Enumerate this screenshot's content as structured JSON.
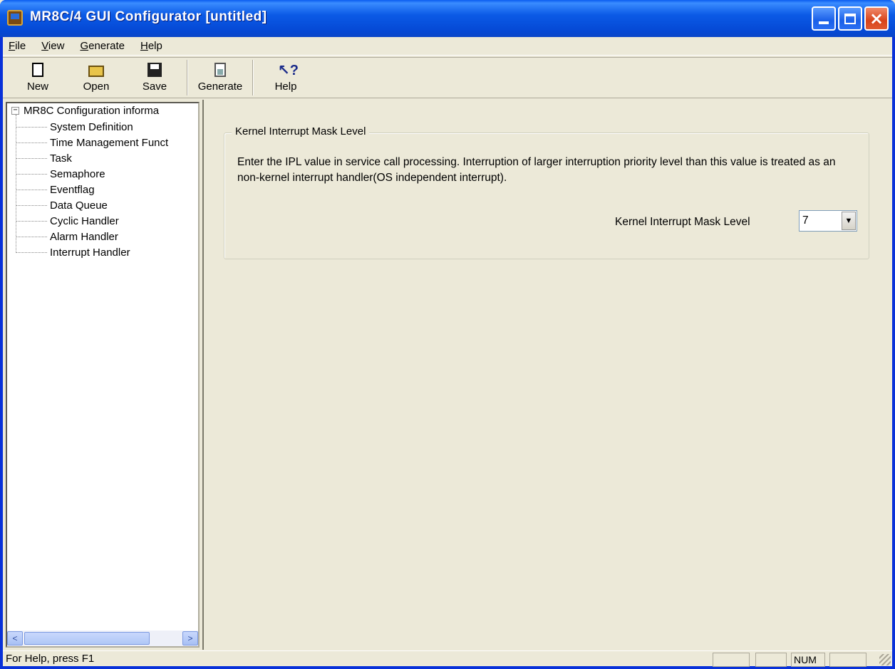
{
  "window": {
    "title": "MR8C/4 GUI Configurator [untitled]"
  },
  "menu": [
    {
      "label": "File",
      "accel": "F",
      "rest": "ile"
    },
    {
      "label": "View",
      "accel": "V",
      "rest": "iew"
    },
    {
      "label": "Generate",
      "accel": "G",
      "rest": "enerate"
    },
    {
      "label": "Help",
      "accel": "H",
      "rest": "elp"
    }
  ],
  "toolbar": {
    "new_label": "New",
    "open_label": "Open",
    "save_label": "Save",
    "generate_label": "Generate",
    "help_label": "Help"
  },
  "tree": {
    "root_label": "MR8C Configuration informa",
    "root_expander": "−",
    "items": [
      "System Definition",
      "Time Management Funct",
      "Task",
      "Semaphore",
      "Eventflag",
      "Data Queue",
      "Cyclic Handler",
      "Alarm Handler",
      "Interrupt Handler"
    ]
  },
  "panel": {
    "group_title": "Kernel Interrupt Mask Level",
    "description": "Enter the IPL value in service call processing. Interruption of larger interruption priority level than this value is treated as an non-kernel interrupt handler(OS independent interrupt).",
    "field_label": "Kernel Interrupt Mask Level",
    "field_value": "7"
  },
  "status": {
    "help_text": "For Help, press F1",
    "num_indicator": "NUM"
  }
}
